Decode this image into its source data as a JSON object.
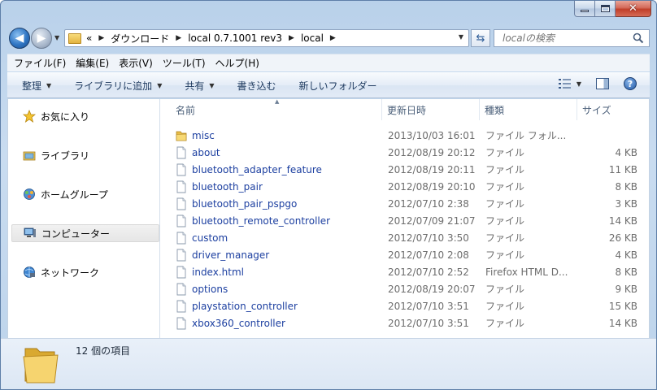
{
  "nav": {
    "breadcrumb_overflow": "«",
    "breadcrumbs": [
      "ダウンロード",
      "local 0.7.1001 rev3",
      "local"
    ],
    "search_placeholder": "localの検索"
  },
  "menu": [
    "ファイル(F)",
    "編集(E)",
    "表示(V)",
    "ツール(T)",
    "ヘルプ(H)"
  ],
  "commands": {
    "organize": "整理",
    "add_to_library": "ライブラリに追加",
    "share": "共有",
    "burn": "書き込む",
    "new_folder": "新しいフォルダー"
  },
  "sidebar": {
    "items": [
      {
        "label": "お気に入り",
        "icon": "star-icon"
      },
      {
        "label": "ライブラリ",
        "icon": "library-icon"
      },
      {
        "label": "ホームグループ",
        "icon": "homegroup-icon"
      },
      {
        "label": "コンピューター",
        "icon": "computer-icon",
        "selected": true
      },
      {
        "label": "ネットワーク",
        "icon": "network-icon"
      }
    ]
  },
  "columns": {
    "name": "名前",
    "date": "更新日時",
    "type": "種類",
    "size": "サイズ"
  },
  "files": [
    {
      "name": "misc",
      "date": "2013/10/03 16:01",
      "type": "ファイル フォル...",
      "size": "",
      "icon": "folder-icon"
    },
    {
      "name": "about",
      "date": "2012/08/19 20:12",
      "type": "ファイル",
      "size": "4 KB",
      "icon": "file-icon"
    },
    {
      "name": "bluetooth_adapter_feature",
      "date": "2012/08/19 20:11",
      "type": "ファイル",
      "size": "11 KB",
      "icon": "file-icon"
    },
    {
      "name": "bluetooth_pair",
      "date": "2012/08/19 20:10",
      "type": "ファイル",
      "size": "8 KB",
      "icon": "file-icon"
    },
    {
      "name": "bluetooth_pair_pspgo",
      "date": "2012/07/10 2:38",
      "type": "ファイル",
      "size": "3 KB",
      "icon": "file-icon"
    },
    {
      "name": "bluetooth_remote_controller",
      "date": "2012/07/09 21:07",
      "type": "ファイル",
      "size": "14 KB",
      "icon": "file-icon"
    },
    {
      "name": "custom",
      "date": "2012/07/10 3:50",
      "type": "ファイル",
      "size": "26 KB",
      "icon": "file-icon"
    },
    {
      "name": "driver_manager",
      "date": "2012/07/10 2:08",
      "type": "ファイル",
      "size": "4 KB",
      "icon": "file-icon"
    },
    {
      "name": "index.html",
      "date": "2012/07/10 2:52",
      "type": "Firefox HTML D...",
      "size": "8 KB",
      "icon": "file-icon"
    },
    {
      "name": "options",
      "date": "2012/08/19 20:07",
      "type": "ファイル",
      "size": "9 KB",
      "icon": "file-icon"
    },
    {
      "name": "playstation_controller",
      "date": "2012/07/10 3:51",
      "type": "ファイル",
      "size": "15 KB",
      "icon": "file-icon"
    },
    {
      "name": "xbox360_controller",
      "date": "2012/07/10 3:51",
      "type": "ファイル",
      "size": "14 KB",
      "icon": "file-icon"
    }
  ],
  "details": {
    "item_count": "12 個の項目"
  },
  "colors": {
    "file_name": "#1c3fa0",
    "meta_text": "#6d6d6d",
    "frame": "#b9d1ea",
    "close_button": "#c13f2a"
  }
}
